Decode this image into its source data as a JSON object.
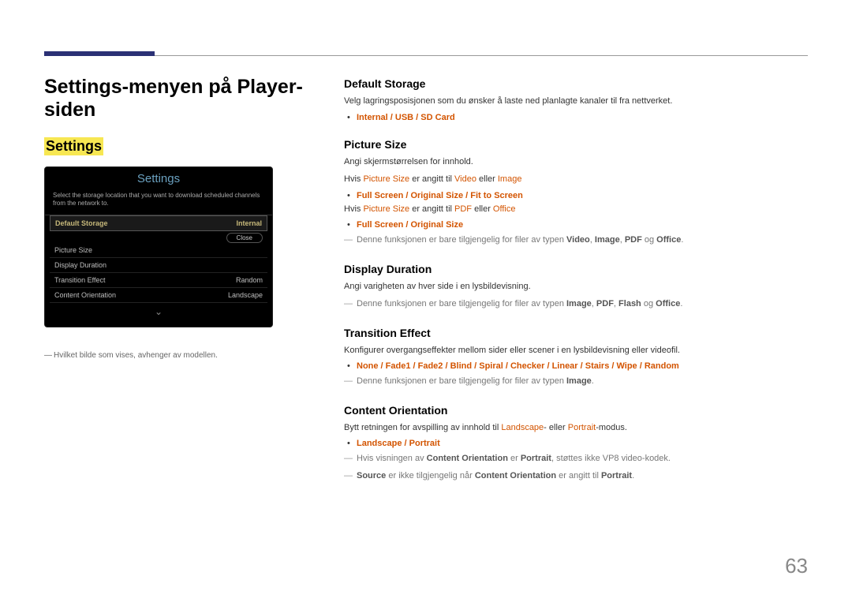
{
  "pageNumber": "63",
  "left": {
    "title": "Settings-menyen på Player-siden",
    "memo": "Settings",
    "osd": {
      "title": "Settings",
      "desc": "Select the storage location that you want to download scheduled channels from the network to.",
      "rows": [
        {
          "label": "Default Storage",
          "value": "Internal",
          "hl": true
        },
        {
          "label": "Picture Size",
          "value": ""
        },
        {
          "label": "Display Duration",
          "value": ""
        },
        {
          "label": "Transition Effect",
          "value": "Random"
        },
        {
          "label": "Content Orientation",
          "value": "Landscape"
        }
      ],
      "close": "Close"
    },
    "footnote": "Hvilket bilde som vises, avhenger av modellen."
  },
  "right": {
    "defaultStorage": {
      "h": "Default Storage",
      "p": "Velg lagringsposisjonen som du ønsker å laste ned planlagte kanaler til fra nettverket.",
      "opts": "Internal / USB / SD Card"
    },
    "pictureSize": {
      "h": "Picture Size",
      "p1": "Angi skjermstørrelsen for innhold.",
      "hvis1_a": "Hvis ",
      "hvis1_ps": "Picture Size",
      "hvis1_b": " er angitt til ",
      "hvis1_v": "Video",
      "hvis1_or": " eller ",
      "hvis1_img": "Image",
      "opts1": "Full Screen / Original Size / Fit to Screen",
      "hvis2_a": "Hvis ",
      "hvis2_ps": "Picture Size",
      "hvis2_b": " er angitt til ",
      "hvis2_pdf": "PDF",
      "hvis2_or": " eller ",
      "hvis2_off": "Office",
      "opts2": "Full Screen / Original Size",
      "note_a": "Denne funksjonen er bare tilgjengelig for filer av typen ",
      "note_v": "Video",
      "note_c1": ", ",
      "note_img": "Image",
      "note_c2": ", ",
      "note_pdf": "PDF",
      "note_og": " og ",
      "note_off": "Office",
      "note_dot": "."
    },
    "displayDuration": {
      "h": "Display Duration",
      "p": "Angi varigheten av hver side i en lysbildevisning.",
      "note_a": "Denne funksjonen er bare tilgjengelig for filer av typen ",
      "note_img": "Image",
      "note_c1": ", ",
      "note_pdf": "PDF",
      "note_c2": ", ",
      "note_flash": "Flash",
      "note_og": " og ",
      "note_off": "Office",
      "note_dot": "."
    },
    "transitionEffect": {
      "h": "Transition Effect",
      "p": "Konfigurer overgangseffekter mellom sider eller scener i en lysbildevisning eller videofil.",
      "opts": "None / Fade1 / Fade2 / Blind / Spiral / Checker / Linear / Stairs / Wipe / Random",
      "note_a": "Denne funksjonen er bare tilgjengelig for filer av typen ",
      "note_img": "Image",
      "note_dot": "."
    },
    "contentOrientation": {
      "h": "Content Orientation",
      "p_a": "Bytt retningen for avspilling av innhold til ",
      "p_land": "Landscape",
      "p_b": "- eller ",
      "p_port": "Portrait",
      "p_c": "-modus.",
      "opts": "Landscape / Portrait",
      "note1_a": "Hvis visningen av ",
      "note1_co": "Content Orientation",
      "note1_b": " er ",
      "note1_port": "Portrait",
      "note1_c": ", støttes ikke VP8 video-kodek.",
      "note2_src": "Source",
      "note2_a": " er ikke tilgjengelig når ",
      "note2_co": "Content Orientation",
      "note2_b": " er angitt til ",
      "note2_port": "Portrait",
      "note2_dot": "."
    }
  }
}
